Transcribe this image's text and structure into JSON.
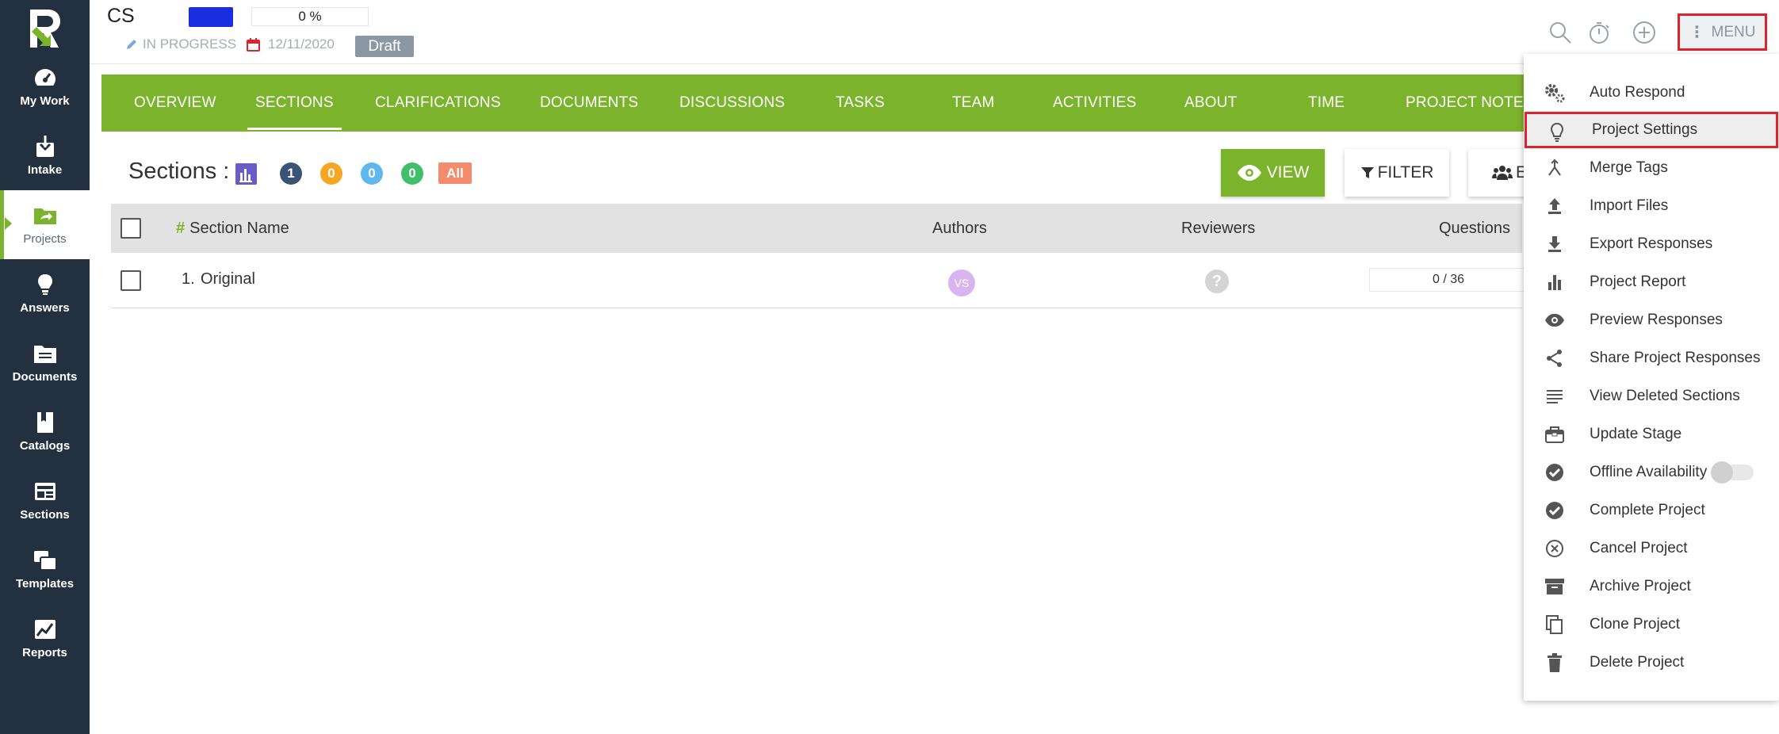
{
  "sidebar": {
    "items": [
      {
        "label": "My Work",
        "icon": "gauge-icon"
      },
      {
        "label": "Intake",
        "icon": "inbox-download-icon"
      },
      {
        "label": "Projects",
        "icon": "folder-share-icon"
      },
      {
        "label": "Answers",
        "icon": "lightbulb-icon"
      },
      {
        "label": "Documents",
        "icon": "folder-icon"
      },
      {
        "label": "Catalogs",
        "icon": "book-icon"
      },
      {
        "label": "Sections",
        "icon": "sections-icon"
      },
      {
        "label": "Templates",
        "icon": "templates-icon"
      },
      {
        "label": "Reports",
        "icon": "chart-image-icon"
      }
    ]
  },
  "header": {
    "title": "CS",
    "progress": "0 %",
    "status": "IN PROGRESS",
    "due_date": "12/11/2020",
    "stage": "Draft",
    "menu_label": "MENU",
    "menu_dots": "⋮",
    "color_chip": "#1a2ee0"
  },
  "tabs": [
    {
      "label": "OVERVIEW"
    },
    {
      "label": "SECTIONS"
    },
    {
      "label": "CLARIFICATIONS"
    },
    {
      "label": "DOCUMENTS"
    },
    {
      "label": "DISCUSSIONS"
    },
    {
      "label": "TASKS"
    },
    {
      "label": "TEAM"
    },
    {
      "label": "ACTIVITIES"
    },
    {
      "label": "ABOUT"
    },
    {
      "label": "TIME"
    },
    {
      "label": "PROJECT NOTES"
    }
  ],
  "sections": {
    "label": "Sections :",
    "badges": [
      "1",
      "0",
      "0",
      "0"
    ],
    "badge_all": "All",
    "view_button": "VIEW",
    "filter_button": "FILTER",
    "team_button": "E"
  },
  "table": {
    "headers": {
      "hash": "#",
      "name": "Section Name",
      "authors": "Authors",
      "reviewers": "Reviewers",
      "questions": "Questions"
    },
    "rows": [
      {
        "index": "1.",
        "name": "Original",
        "author_initials": "VS",
        "reviewer": "?",
        "questions": "0 / 36"
      }
    ]
  },
  "menu": {
    "items": [
      {
        "label": "Auto Respond",
        "icon": "gears-icon"
      },
      {
        "label": "Project Settings",
        "icon": "lightbulb-outline-icon"
      },
      {
        "label": "Merge Tags",
        "icon": "merge-icon"
      },
      {
        "label": "Import Files",
        "icon": "upload-icon"
      },
      {
        "label": "Export Responses",
        "icon": "download-icon"
      },
      {
        "label": "Project Report",
        "icon": "bar-chart-icon"
      },
      {
        "label": "Preview Responses",
        "icon": "eye-icon"
      },
      {
        "label": "Share Project Responses",
        "icon": "share-icon"
      },
      {
        "label": "View Deleted Sections",
        "icon": "lines-icon"
      },
      {
        "label": "Update Stage",
        "icon": "stage-icon"
      },
      {
        "label": "Offline Availability",
        "icon": "check-circle-icon"
      },
      {
        "label": "Complete Project",
        "icon": "check-circle-filled-icon"
      },
      {
        "label": "Cancel Project",
        "icon": "cancel-circle-icon"
      },
      {
        "label": "Archive Project",
        "icon": "archive-icon"
      },
      {
        "label": "Clone Project",
        "icon": "copy-icon"
      },
      {
        "label": "Delete Project",
        "icon": "trash-icon"
      }
    ]
  },
  "colors": {
    "sidebar": "#233040",
    "accent": "#7cb32c",
    "highlight": "#e0222a"
  }
}
